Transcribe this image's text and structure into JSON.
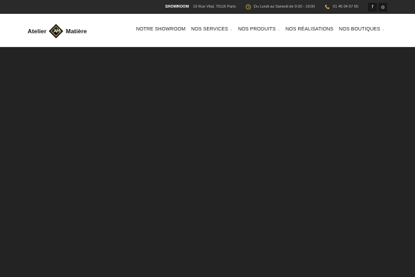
{
  "topbar": {
    "address_label": "SHOWROOM",
    "address_text": "19 Rue Vital, 75116 Paris",
    "hours_text": "Du Lundi au Samedi de 9:30 - 19:00",
    "phone_text": "01 45 04 67 65",
    "social": [
      {
        "glyph": "f",
        "icon": "facebook-icon"
      },
      {
        "glyph": "◎",
        "icon": "instagram-icon"
      }
    ],
    "colors": {
      "background": "#2a2a2a",
      "accent": "#c9a64a"
    }
  },
  "header": {
    "logo_left": "Atelier",
    "logo_right": "Matière",
    "nav": [
      {
        "label": "NOTRE SHOWROOM",
        "has_dropdown": false
      },
      {
        "label": "NOS SERVICES",
        "has_dropdown": true
      },
      {
        "label": "NOS PRODUITS",
        "has_dropdown": true
      },
      {
        "label": "NOS RÉALISATIONS",
        "has_dropdown": false
      },
      {
        "label": "NOS BOUTIQUES",
        "has_dropdown": true
      }
    ]
  },
  "main": {
    "background": "#232323"
  }
}
